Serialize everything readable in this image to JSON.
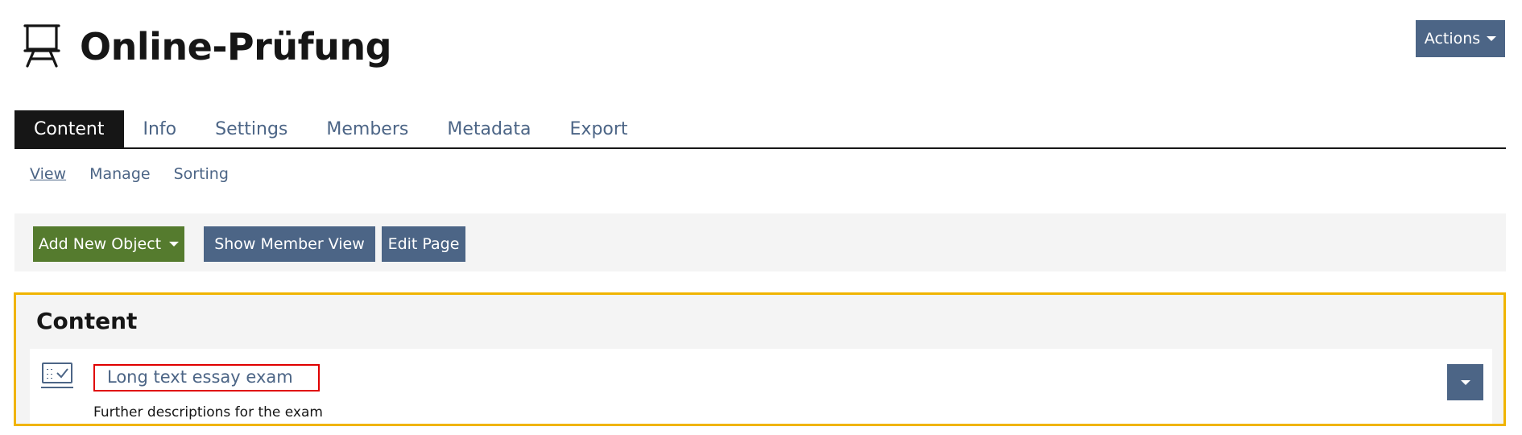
{
  "header": {
    "title": "Online-Prüfung",
    "icon": "presentation-board-icon",
    "actions_label": "Actions"
  },
  "tabs": [
    {
      "label": "Content",
      "active": true
    },
    {
      "label": "Info",
      "active": false
    },
    {
      "label": "Settings",
      "active": false
    },
    {
      "label": "Members",
      "active": false
    },
    {
      "label": "Metadata",
      "active": false
    },
    {
      "label": "Export",
      "active": false
    }
  ],
  "subtabs": [
    {
      "label": "View",
      "active": true
    },
    {
      "label": "Manage",
      "active": false
    },
    {
      "label": "Sorting",
      "active": false
    }
  ],
  "toolbar": {
    "add_new_object_label": "Add New Object",
    "show_member_view_label": "Show Member View",
    "edit_page_label": "Edit Page"
  },
  "content_block": {
    "title": "Content",
    "items": [
      {
        "title": "Long text essay exam",
        "description": "Further descriptions for the exam",
        "icon": "test-checklist-icon"
      }
    ]
  },
  "colors": {
    "primary": "#4c6586",
    "add_button": "#557b2e",
    "active_tab": "#161616",
    "panel_highlight": "#f0b400",
    "item_highlight": "#e00000",
    "toolbar_bg": "#f4f4f4"
  }
}
